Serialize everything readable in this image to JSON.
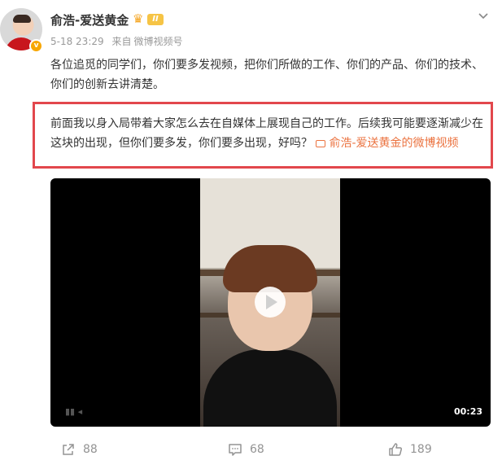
{
  "post": {
    "username": "俞浩-爱送黄金",
    "level_badge": "II",
    "timestamp": "5-18 23:29",
    "source_prefix": "来自",
    "source": "微博视频号",
    "paragraph1": "各位追觅的同学们，你们要多发视频，把你们所做的工作、你们的产品、你们的技术、你们的创新去讲清楚。",
    "paragraph2": "前面我以身入局带着大家怎么去在自媒体上展现自己的工作。后续我可能要逐渐减少在这块的出现，但你们要多发，你们要多出现，好吗？",
    "video_link": "俞浩-爱送黄金的微博视频"
  },
  "video": {
    "duration": "00:23"
  },
  "actions": {
    "share_count": "88",
    "comment_count": "68",
    "like_count": "189"
  },
  "colors": {
    "highlight_border": "#e2474c",
    "link": "#eb7340",
    "muted": "#999999"
  },
  "icons": {
    "dropdown": "chevron-down-icon",
    "share": "share-icon",
    "comment": "comment-icon",
    "like": "thumbs-up-icon",
    "play": "play-icon"
  }
}
